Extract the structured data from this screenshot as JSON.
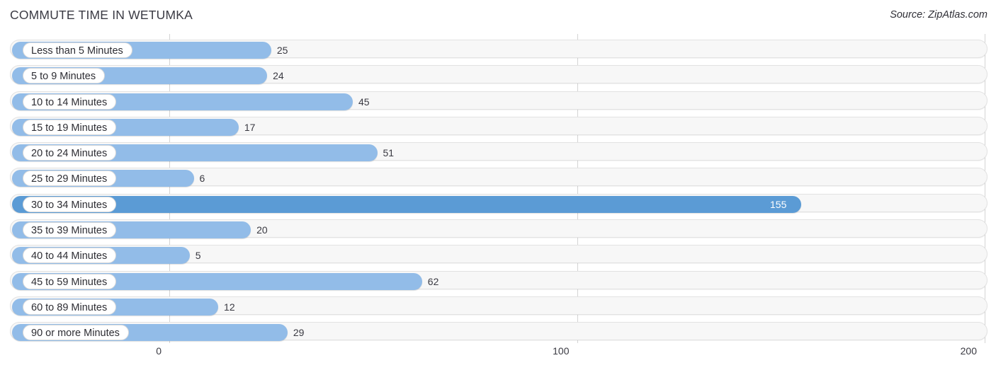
{
  "header": {
    "title": "COMMUTE TIME IN WETUMKA",
    "source": "Source: ZipAtlas.com"
  },
  "colors": {
    "bar": "#92bce8",
    "bar_highlight": "#5b9bd5",
    "track": "#f7f7f7",
    "gridline": "#d4d4d4",
    "text": "#3a3a42"
  },
  "chart_data": {
    "type": "bar",
    "orientation": "horizontal",
    "title": "COMMUTE TIME IN WETUMKA",
    "xlabel": "",
    "ylabel": "",
    "xlim": [
      0,
      200
    ],
    "xticks": [
      0,
      100,
      200
    ],
    "xtick_labels": [
      "0",
      "100",
      "200"
    ],
    "grid": true,
    "legend": false,
    "highlight_category": "30 to 34 Minutes",
    "categories": [
      "Less than 5 Minutes",
      "5 to 9 Minutes",
      "10 to 14 Minutes",
      "15 to 19 Minutes",
      "20 to 24 Minutes",
      "25 to 29 Minutes",
      "30 to 34 Minutes",
      "35 to 39 Minutes",
      "40 to 44 Minutes",
      "45 to 59 Minutes",
      "60 to 89 Minutes",
      "90 or more Minutes"
    ],
    "values": [
      25,
      24,
      45,
      17,
      51,
      6,
      155,
      20,
      5,
      62,
      12,
      29
    ],
    "value_labels": [
      "25",
      "24",
      "45",
      "17",
      "51",
      "6",
      "155",
      "20",
      "5",
      "62",
      "12",
      "29"
    ]
  }
}
